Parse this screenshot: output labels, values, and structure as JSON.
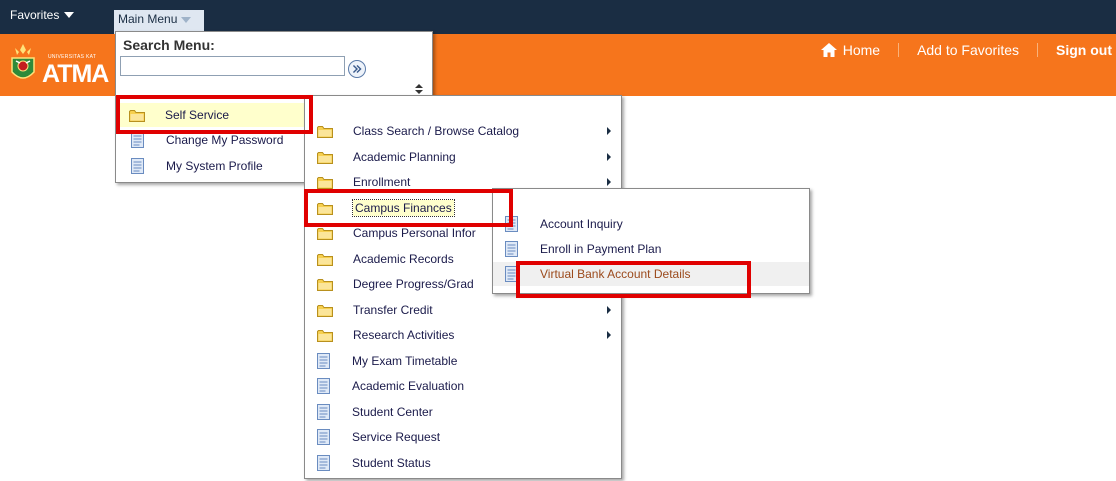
{
  "topbar": {
    "favorites_label": "Favorites",
    "main_menu_label": "Main Menu"
  },
  "header": {
    "logo_small_text": "UNIVERSITAS KAT",
    "logo_text": "ATMA",
    "home_label": "Home",
    "add_favorites_label": "Add to Favorites",
    "signout_label": "Sign out"
  },
  "search": {
    "title": "Search Menu:",
    "value": "",
    "placeholder": ""
  },
  "menu_level1": [
    {
      "label": "Self Service",
      "icon": "folder-icon"
    },
    {
      "label": "Change My Password",
      "icon": "document-icon"
    },
    {
      "label": "My System Profile",
      "icon": "document-icon"
    }
  ],
  "menu_level2": [
    {
      "label": "Class Search / Browse Catalog",
      "icon": "folder-icon",
      "submenu": true
    },
    {
      "label": "Academic Planning",
      "icon": "folder-icon",
      "submenu": true
    },
    {
      "label": "Enrollment",
      "icon": "folder-icon",
      "submenu": true
    },
    {
      "label": "Campus Finances",
      "icon": "folder-icon",
      "submenu": true
    },
    {
      "label": "Campus Personal Infor",
      "icon": "folder-icon",
      "submenu": true
    },
    {
      "label": "Academic Records",
      "icon": "folder-icon",
      "submenu": true
    },
    {
      "label": "Degree Progress/Grad",
      "icon": "folder-icon",
      "submenu": true
    },
    {
      "label": "Transfer Credit",
      "icon": "folder-icon",
      "submenu": true
    },
    {
      "label": "Research Activities",
      "icon": "folder-icon",
      "submenu": true
    },
    {
      "label": "My Exam Timetable",
      "icon": "document-icon"
    },
    {
      "label": "Academic Evaluation",
      "icon": "document-icon"
    },
    {
      "label": "Student Center",
      "icon": "document-icon"
    },
    {
      "label": "Service Request",
      "icon": "document-icon"
    },
    {
      "label": "Student Status",
      "icon": "document-icon"
    }
  ],
  "menu_level3": [
    {
      "label": "Account Inquiry",
      "icon": "document-icon"
    },
    {
      "label": "Enroll in Payment Plan",
      "icon": "document-icon"
    },
    {
      "label": "Virtual Bank Account Details",
      "icon": "document-icon"
    }
  ],
  "colors": {
    "topbar": "#1a2d43",
    "header_orange": "#f6751c",
    "highlight_box": "#e00000",
    "hover_yellow": "#ffffcc",
    "hover_link": "#9b4a1c"
  }
}
